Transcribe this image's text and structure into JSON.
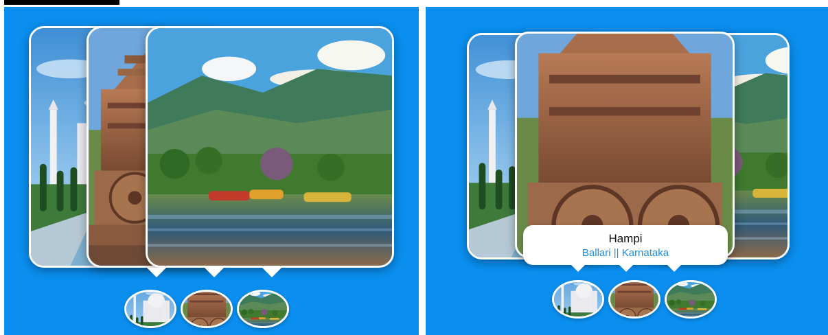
{
  "colors": {
    "panel": "#0a8ff0",
    "frame": "#ffffff",
    "subtitle": "#1a8fe6"
  },
  "slides": [
    {
      "icon": "taj-mahal-image"
    },
    {
      "icon": "hampi-chariot-image"
    },
    {
      "icon": "dal-lake-image"
    }
  ],
  "caption": {
    "title": "Hampi",
    "subtitle": "Ballari || Karnataka"
  }
}
